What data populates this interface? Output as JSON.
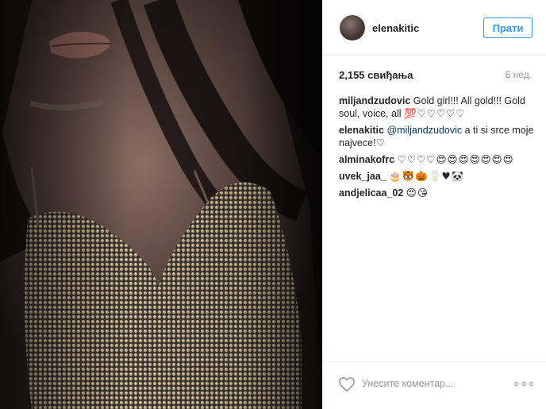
{
  "post": {
    "username": "elenakitic",
    "follow_label": "Прати",
    "likes": "2,155 свиђања",
    "time_ago": "6 нед."
  },
  "comments": [
    {
      "user": "miljandzudovic",
      "text": "Gold girl!!! All gold!!! Gold soul, voice, all ",
      "emoji": "💯♡♡♡♡♡"
    },
    {
      "user": "elenakitic",
      "mention": "@miljandzudovic",
      "text": " a ti si srce moje najvece!",
      "emoji": "♡"
    },
    {
      "user": "alminakofrc",
      "text": " ",
      "emoji": "♡♡♡♡😍😍😍😍😍😍😍"
    },
    {
      "user": "uvek_jaa_",
      "text": " ",
      "emoji": "🎂🐯🎃🥛♥🐼"
    },
    {
      "user": "andjelicaa_02",
      "text": " ",
      "emoji": "😍😘"
    }
  ],
  "footer": {
    "comment_placeholder": "Унесите коментар...",
    "like_icon": "heart-outline-icon",
    "more_icon": "more-options-icon"
  },
  "colors": {
    "accent": "#3897f0",
    "mention": "#003569",
    "muted": "#999999",
    "border": "#efefef"
  }
}
